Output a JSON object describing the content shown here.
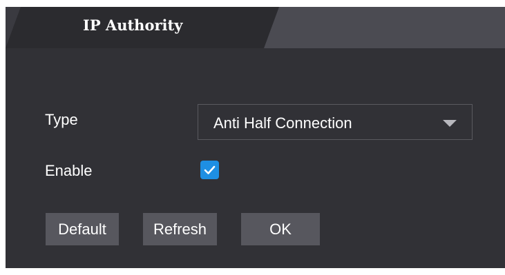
{
  "tab": {
    "title": "IP Authority"
  },
  "form": {
    "type_label": "Type",
    "type_value": "Anti Half Connection",
    "enable_label": "Enable",
    "enable_checked": true
  },
  "buttons": {
    "default": "Default",
    "refresh": "Refresh",
    "ok": "OK"
  },
  "icons": {
    "dropdown": "chevron-down-icon",
    "checkbox": "checkmark-icon"
  },
  "colors": {
    "panel_bg": "#313136",
    "inactive_tab": "#4b4b52",
    "checkbox_accent": "#1e8fe3",
    "button_bg": "#57575e"
  }
}
